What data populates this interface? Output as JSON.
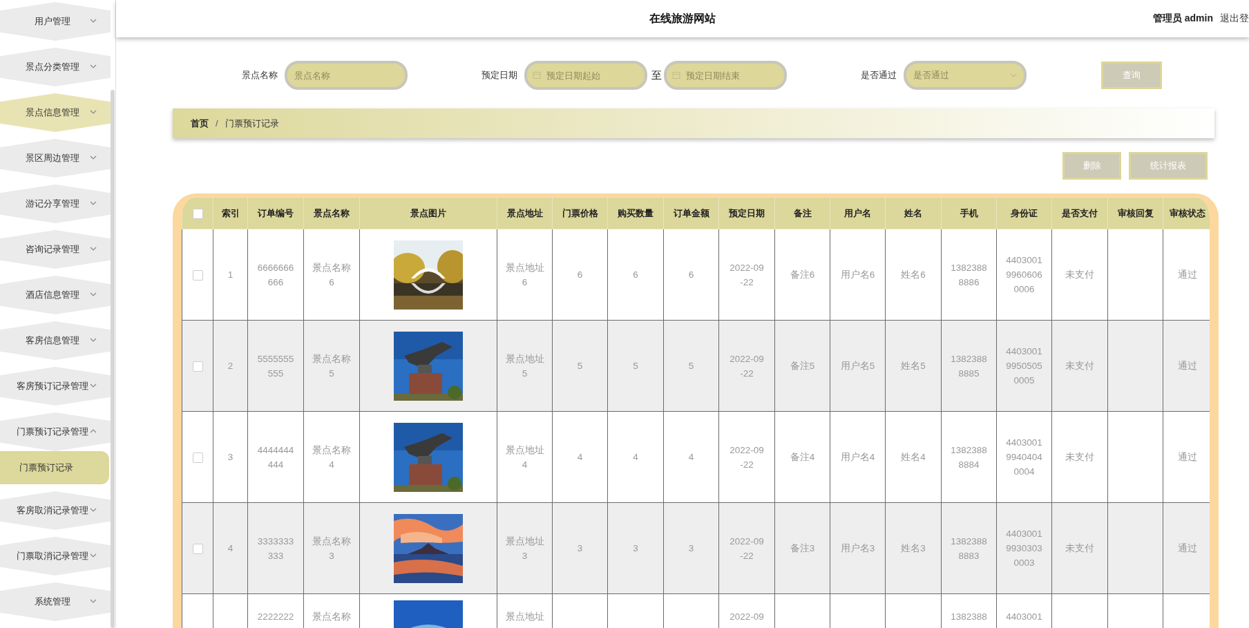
{
  "sidebar": {
    "items": [
      {
        "label": "用户管理",
        "selected": false,
        "expanded": false
      },
      {
        "label": "景点分类管理",
        "selected": false,
        "expanded": false
      },
      {
        "label": "景点信息管理",
        "selected": true,
        "expanded": false
      },
      {
        "label": "景区周边管理",
        "selected": false,
        "expanded": false
      },
      {
        "label": "游记分享管理",
        "selected": false,
        "expanded": false
      },
      {
        "label": "咨询记录管理",
        "selected": false,
        "expanded": false
      },
      {
        "label": "酒店信息管理",
        "selected": false,
        "expanded": false
      },
      {
        "label": "客房信息管理",
        "selected": false,
        "expanded": false
      },
      {
        "label": "客房预订记录管理",
        "selected": false,
        "expanded": false
      },
      {
        "label": "门票预订记录管理",
        "selected": false,
        "expanded": true,
        "children": [
          {
            "label": "门票预订记录",
            "selected": true
          }
        ]
      },
      {
        "label": "客房取消记录管理",
        "selected": false,
        "expanded": false
      },
      {
        "label": "门票取消记录管理",
        "selected": false,
        "expanded": false
      },
      {
        "label": "系统管理",
        "selected": false,
        "expanded": false
      }
    ]
  },
  "header": {
    "title": "在线旅游网站",
    "user": "管理员 admin",
    "logout": "退出登"
  },
  "search": {
    "fields": [
      {
        "kind": "text",
        "label": "景点名称",
        "placeholder": "景点名称"
      },
      {
        "kind": "daterange",
        "label": "预定日期",
        "placeholder": "预定日期起始",
        "separator": "至",
        "placeholder_end": "预定日期结束"
      },
      {
        "kind": "select",
        "label": "是否通过",
        "placeholder": "是否通过"
      }
    ],
    "button": "查询"
  },
  "breadcrumb": {
    "items": [
      "首页",
      "门票预订记录"
    ],
    "separator": "/"
  },
  "actions": [
    "删除",
    "统计报表"
  ],
  "table": {
    "select_all": {
      "checked": false
    },
    "columns": [
      "索引",
      "订单编号",
      "景点名称",
      "景点图片",
      "景点地址",
      "门票价格",
      "购买数量",
      "订单金额",
      "预定日期",
      "备注",
      "用户名",
      "姓名",
      "手机",
      "身份证",
      "是否支付",
      "审核回复",
      "审核状态"
    ],
    "rows": [
      {
        "checked": false,
        "index": "1",
        "order_no": "6666666666",
        "name": "景点名称6",
        "address": "景点地址6",
        "price": "6",
        "quantity": "6",
        "amount": "6",
        "date": "2022-09-22",
        "note": "备注6",
        "username": "用户名6",
        "real_name": "姓名6",
        "phone": "13823888886",
        "id_card": "440300199606060006",
        "paid": "未支付",
        "status": "通过"
      },
      {
        "checked": false,
        "index": "2",
        "order_no": "5555555555",
        "name": "景点名称5",
        "address": "景点地址5",
        "price": "5",
        "quantity": "5",
        "amount": "5",
        "date": "2022-09-22",
        "note": "备注5",
        "username": "用户名5",
        "real_name": "姓名5",
        "phone": "13823888885",
        "id_card": "440300199505050005",
        "paid": "未支付",
        "status": "通过"
      },
      {
        "checked": false,
        "index": "3",
        "order_no": "4444444444",
        "name": "景点名称4",
        "address": "景点地址4",
        "price": "4",
        "quantity": "4",
        "amount": "4",
        "date": "2022-09-22",
        "note": "备注4",
        "username": "用户名4",
        "real_name": "姓名4",
        "phone": "13823888884",
        "id_card": "440300199404040004",
        "paid": "未支付",
        "status": "通过"
      },
      {
        "checked": false,
        "index": "4",
        "order_no": "3333333333",
        "name": "景点名称3",
        "address": "景点地址3",
        "price": "3",
        "quantity": "3",
        "amount": "3",
        "date": "2022-09-22",
        "note": "备注3",
        "username": "用户名3",
        "real_name": "姓名3",
        "phone": "13823888883",
        "id_card": "440300199303030003",
        "paid": "未支付",
        "status": "通过"
      },
      {
        "order_no": "2222222",
        "name": "景点名称",
        "address": "景点地址",
        "date": "2022-09",
        "phone": "1382388",
        "id_card": "4403001"
      }
    ]
  }
}
